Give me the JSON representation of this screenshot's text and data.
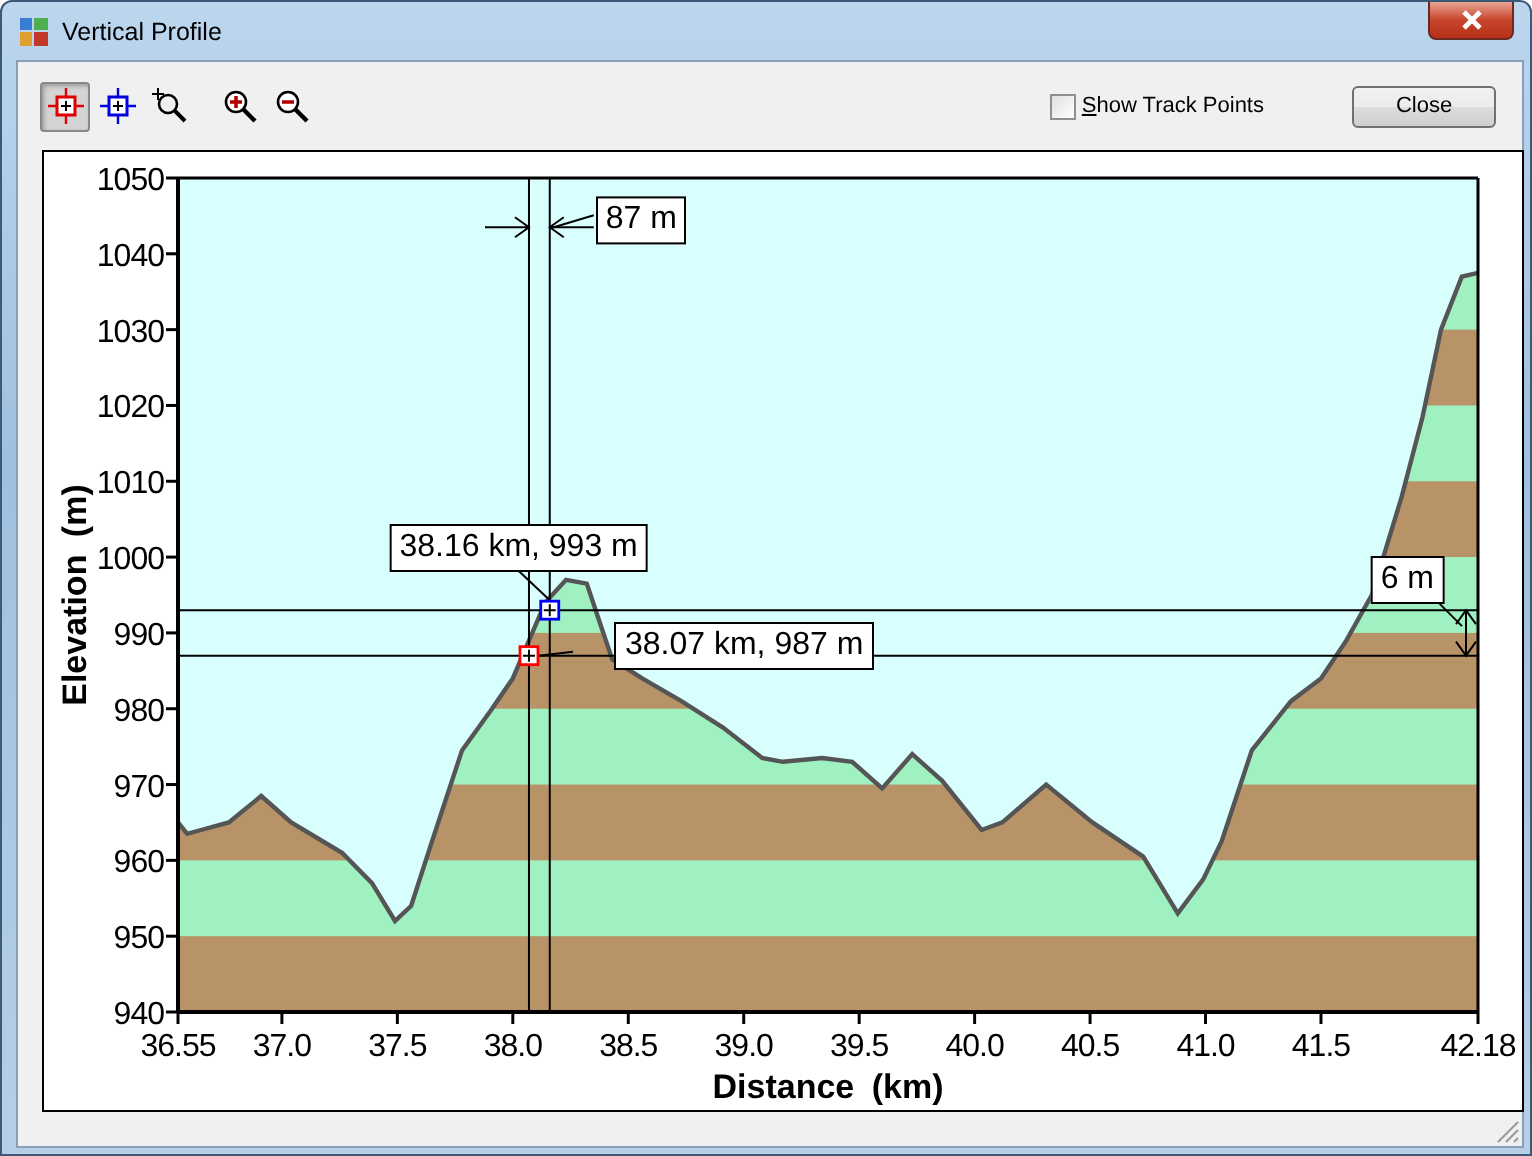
{
  "window": {
    "title": "Vertical Profile"
  },
  "toolbar": {
    "tools": [
      {
        "kind": "red-cursor",
        "selected": true
      },
      {
        "kind": "blue-cursor",
        "selected": false
      },
      {
        "kind": "zoom-box",
        "selected": false
      },
      {
        "kind": "zoom-in",
        "selected": false
      },
      {
        "kind": "zoom-out",
        "selected": false
      }
    ],
    "show_track_points": {
      "label": "Show Track Points",
      "checked": false
    },
    "close_button": "Close"
  },
  "chart": {
    "chart_data": {
      "type": "area",
      "xlabel": "Distance (km)",
      "ylabel": "Elevation (m)",
      "x": [
        36.55,
        36.59,
        36.65,
        36.77,
        36.91,
        37.04,
        37.26,
        37.39,
        37.49,
        37.56,
        37.65,
        37.78,
        37.91,
        38.0,
        38.14,
        38.23,
        38.32,
        38.37,
        38.43,
        38.56,
        38.73,
        38.91,
        39.08,
        39.17,
        39.34,
        39.47,
        39.6,
        39.73,
        39.86,
        40.03,
        40.12,
        40.31,
        40.51,
        40.73,
        40.88,
        40.99,
        41.07,
        41.2,
        41.37,
        41.5,
        41.61,
        41.72,
        41.85,
        41.94,
        42.02,
        42.11,
        42.18
      ],
      "series": [
        {
          "color": "#555555",
          "values": [
            965,
            963.5,
            964,
            965,
            968.5,
            965,
            961,
            957,
            952,
            954,
            962.5,
            974.5,
            980,
            984,
            994,
            997,
            996.5,
            992,
            986.5,
            984,
            981,
            977.5,
            973.5,
            973,
            973.5,
            973,
            969.5,
            974,
            970.5,
            964,
            965,
            970,
            965,
            960.5,
            953,
            957.5,
            962.5,
            974.5,
            981,
            984,
            989,
            995,
            1008,
            1018.5,
            1030,
            1037,
            1037.5
          ]
        }
      ],
      "xlim": [
        36.55,
        42.18
      ],
      "ylim": [
        940,
        1050
      ],
      "xticks": [
        {
          "value": 36.55,
          "label": "36.55"
        },
        {
          "value": 37,
          "label": "37.0"
        },
        {
          "value": 37.5,
          "label": "37.5"
        },
        {
          "value": 38,
          "label": "38.0"
        },
        {
          "value": 38.5,
          "label": "38.5"
        },
        {
          "value": 39,
          "label": "39.0"
        },
        {
          "value": 39.5,
          "label": "39.5"
        },
        {
          "value": 40,
          "label": "40.0"
        },
        {
          "value": 40.5,
          "label": "40.5"
        },
        {
          "value": 41,
          "label": "41.0"
        },
        {
          "value": 41.5,
          "label": "41.5"
        },
        {
          "value": 42.18,
          "label": "42.18"
        }
      ],
      "yticks": [
        940,
        950,
        960,
        970,
        980,
        990,
        1000,
        1010,
        1020,
        1030,
        1040,
        1050
      ],
      "annotations": [
        {
          "text": "38.16 km, 993 m",
          "x": 38.16,
          "y": 993
        },
        {
          "text": "38.07 km, 987 m",
          "x": 38.07,
          "y": 987
        },
        {
          "text": "87 m"
        },
        {
          "text": "6 m"
        }
      ]
    },
    "cursor_markers": [
      {
        "color": "#0000ff"
      },
      {
        "color": "#ff0000"
      }
    ]
  }
}
